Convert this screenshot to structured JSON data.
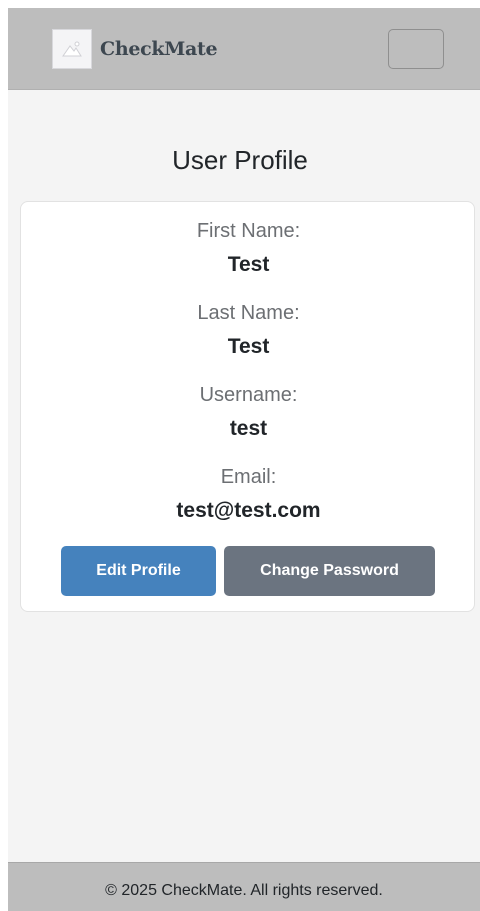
{
  "navbar": {
    "brand_name": "CheckMate",
    "logo_icon": "image-placeholder-icon",
    "toggler_icon": "menu-toggle-icon"
  },
  "page": {
    "title": "User Profile"
  },
  "profile": {
    "fields": [
      {
        "label": "First Name:",
        "value": "Test"
      },
      {
        "label": "Last Name:",
        "value": "Test"
      },
      {
        "label": "Username:",
        "value": "test"
      },
      {
        "label": "Email:",
        "value": "test@test.com"
      }
    ],
    "edit_button_label": "Edit Profile",
    "change_password_button_label": "Change Password"
  },
  "footer": {
    "text": "© 2025 CheckMate. All rights reserved."
  },
  "colors": {
    "navbar_bg": "#bdbdbd",
    "page_bg": "#f4f4f4",
    "primary": "#4582bd",
    "secondary": "#6b7480"
  }
}
